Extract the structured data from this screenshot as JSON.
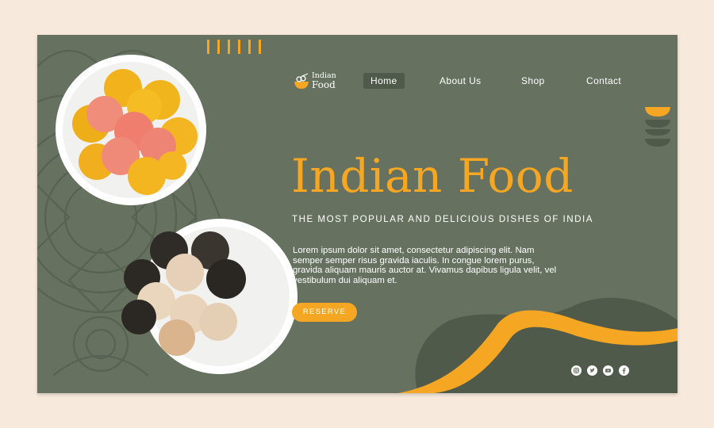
{
  "brand": {
    "line1": "Indian",
    "line2": "Food"
  },
  "nav": [
    {
      "label": "Home",
      "active": true
    },
    {
      "label": "About Us",
      "active": false
    },
    {
      "label": "Shop",
      "active": false
    },
    {
      "label": "Contact",
      "active": false
    }
  ],
  "hero": {
    "title": "Indian Food",
    "subtitle": "THE MOST POPULAR AND DELICIOUS DISHES OF INDIA",
    "body": "Lorem ipsum dolor sit amet, consectetur adipiscing elit. Nam semper semper risus gravida iaculis. In congue lorem purus, gravida aliquam mauris auctor at. Vivamus dapibus ligula velit, vel vestibulum dui aliquam et.",
    "cta": "RESERVE"
  },
  "social": [
    "instagram-icon",
    "twitter-icon",
    "youtube-icon",
    "facebook-icon"
  ],
  "colors": {
    "background": "#667160",
    "accent": "#f5a623",
    "dark_shape": "#505a4a",
    "outer": "#f7e9dc"
  }
}
